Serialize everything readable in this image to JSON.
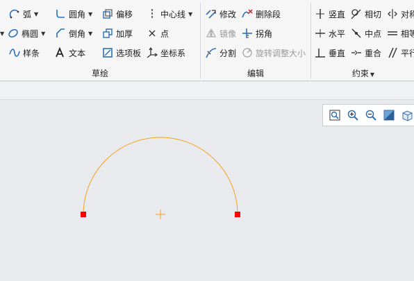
{
  "ribbon": {
    "groups": {
      "sketch": {
        "label": "草绘",
        "commands": {
          "arc": "弧",
          "fillet": "圆角",
          "offset": "偏移",
          "centerline": "中心线",
          "ellipse": "椭圆",
          "chamfer": "倒角",
          "thicken": "加厚",
          "point": "点",
          "spline": "样条",
          "text": "文本",
          "palette": "选项板",
          "coordinate_system": "坐标系"
        }
      },
      "edit": {
        "label": "编辑",
        "commands": {
          "modify": "修改",
          "delete_segment": "删除段",
          "mirror": "镜像",
          "corner": "拐角",
          "divide": "分割",
          "rotate_resize": "旋转调整大小"
        }
      },
      "constrain": {
        "label": "约束",
        "commands": {
          "vertical": "竖直",
          "tangent": "相切",
          "symmetric": "对称",
          "horizontal": "水平",
          "midpoint": "中点",
          "equal": "相等",
          "perpendicular": "垂直",
          "coincident": "重合",
          "parallel": "平行"
        }
      }
    }
  },
  "colors": {
    "arc": "#f4a21b",
    "endpoint": "#ff0000",
    "center_mark": "#f4a21b",
    "icon_blue": "#2a6fb8"
  },
  "view_toolbar": {
    "icons": [
      "refit-icon",
      "zoom-in-icon",
      "zoom-out-icon",
      "repaint-icon",
      "saved-orientations-icon"
    ]
  }
}
